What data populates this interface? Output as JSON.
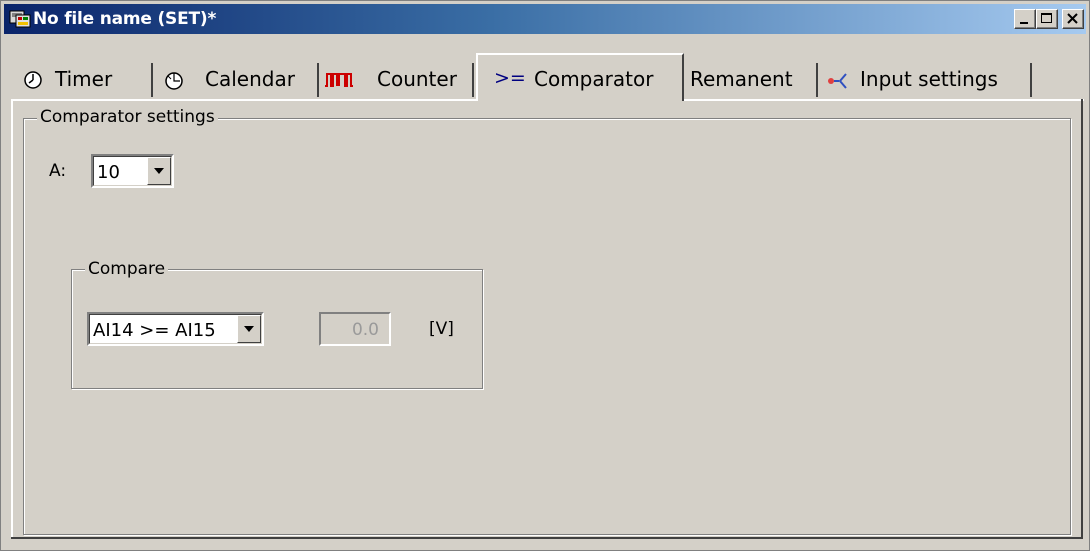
{
  "window": {
    "title": "No file name (SET)*",
    "minimize_icon": "minimize-icon",
    "maximize_icon": "maximize-icon",
    "close_icon": "close-icon"
  },
  "tabs": [
    {
      "label": "Timer",
      "icon": "clock-icon"
    },
    {
      "label": "Calendar",
      "icon": "calendar-clock-icon"
    },
    {
      "label": "Counter",
      "icon": "counter-pulse-icon"
    },
    {
      "label": "Comparator",
      "icon_text": ">="
    },
    {
      "label": "Remanent"
    },
    {
      "label": "Input settings",
      "icon": "input-branch-icon"
    }
  ],
  "active_tab": "Comparator",
  "comparator_settings": {
    "group_title": "Comparator settings",
    "a_label": "A:",
    "a_value": "10"
  },
  "compare": {
    "group_title": "Compare",
    "selection": "AI14 >= AI15",
    "value": "0.0",
    "unit": "[V]"
  },
  "colors": {
    "face": "#d4d0c8",
    "titlebar_start": "#0a246a",
    "titlebar_end": "#a6caf0",
    "counter_icon": "#cc0000",
    "input_icon": "#3050c0"
  }
}
